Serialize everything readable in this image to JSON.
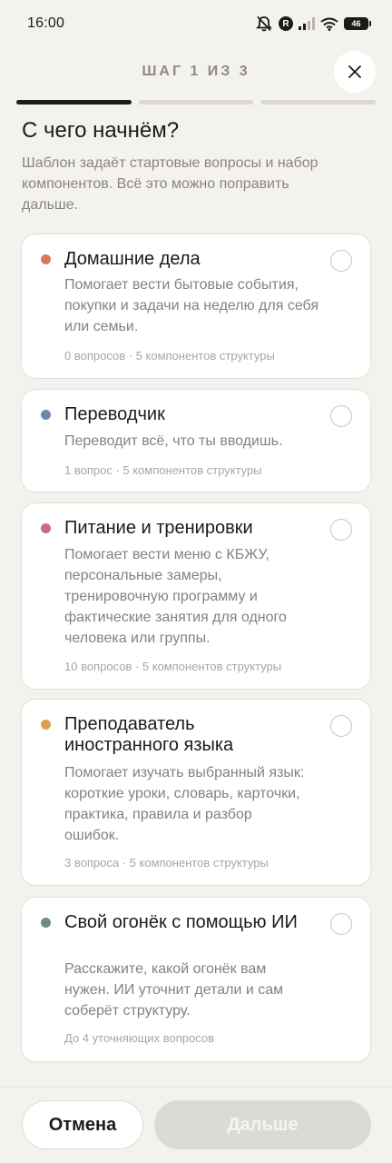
{
  "status_bar": {
    "time": "16:00",
    "icons": [
      "mute-icon",
      "r-badge-icon",
      "signal-icon",
      "wifi-icon",
      "battery-icon"
    ],
    "r_badge": "R",
    "battery": "46"
  },
  "header": {
    "step_label": "ШАГ 1 ИЗ 3",
    "progress": {
      "current": 1,
      "total": 3
    }
  },
  "page": {
    "title": "С чего начнём?",
    "subtitle": "Шаблон задаёт стартовые вопросы и набор компонентов. Всё это можно поправить дальше."
  },
  "templates": [
    {
      "title": "Домашние дела",
      "description": "Помогает вести бытовые события, покупки и задачи на неделю для себя или семьи.",
      "meta": "0 вопросов · 5 компонентов структуры",
      "color": "#d67b5a"
    },
    {
      "title": "Переводчик",
      "description": "Переводит всё, что ты вводишь.",
      "meta": "1 вопрос · 5 компонентов структуры",
      "color": "#6d88b0"
    },
    {
      "title": "Питание и тренировки",
      "description": "Помогает вести меню с КБЖУ, персональные замеры, тренировочную программу и фактические занятия для одного человека или группы.",
      "meta": "10 вопросов · 5 компонентов структуры",
      "color": "#c96a8a"
    },
    {
      "title": "Преподаватель иностранного языка",
      "description": "Помогает изучать выбранный язык: короткие уроки, словарь, карточки, практика, правила и разбор ошибок.",
      "meta": "3 вопроса · 5 компонентов структуры",
      "color": "#d9a24e"
    },
    {
      "title": "Свой огонёк с помощью ИИ",
      "description": "Расскажите, какой огонёк вам нужен. ИИ уточнит детали и сам соберёт структуру.",
      "meta": "До 4 уточняющих вопросов",
      "color": "#6f8f7c"
    }
  ],
  "footer": {
    "cancel_label": "Отмена",
    "next_label": "Дальше"
  }
}
